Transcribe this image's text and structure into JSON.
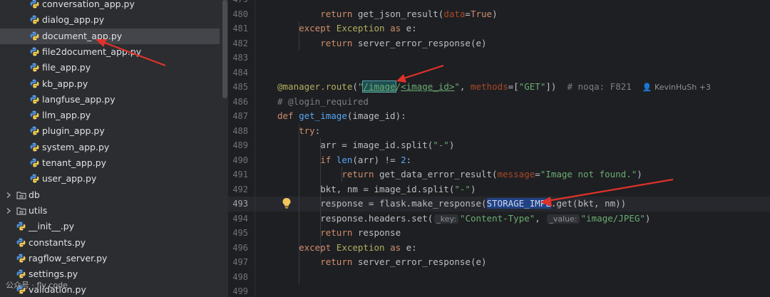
{
  "project_tree": {
    "items": [
      {
        "label": "conversation_app.py",
        "kind": "py",
        "indent": 1
      },
      {
        "label": "dialog_app.py",
        "kind": "py",
        "indent": 1
      },
      {
        "label": "document_app.py",
        "kind": "py",
        "indent": 1,
        "selected": true
      },
      {
        "label": "file2document_app.py",
        "kind": "py",
        "indent": 1
      },
      {
        "label": "file_app.py",
        "kind": "py",
        "indent": 1
      },
      {
        "label": "kb_app.py",
        "kind": "py",
        "indent": 1
      },
      {
        "label": "langfuse_app.py",
        "kind": "py",
        "indent": 1
      },
      {
        "label": "llm_app.py",
        "kind": "py",
        "indent": 1
      },
      {
        "label": "plugin_app.py",
        "kind": "py",
        "indent": 1
      },
      {
        "label": "system_app.py",
        "kind": "py",
        "indent": 1
      },
      {
        "label": "tenant_app.py",
        "kind": "py",
        "indent": 1
      },
      {
        "label": "user_app.py",
        "kind": "py",
        "indent": 1
      },
      {
        "label": "db",
        "kind": "folder",
        "indent": 0
      },
      {
        "label": "utils",
        "kind": "folder",
        "indent": 0
      },
      {
        "label": "__init__.py",
        "kind": "py",
        "indent": 0
      },
      {
        "label": "constants.py",
        "kind": "py",
        "indent": 0
      },
      {
        "label": "ragflow_server.py",
        "kind": "py",
        "indent": 0
      },
      {
        "label": "settings.py",
        "kind": "py",
        "indent": 0
      },
      {
        "label": "validation.py",
        "kind": "py",
        "indent": 0
      }
    ]
  },
  "editor": {
    "current_line": "493",
    "lines": [
      {
        "n": "479",
        "html": ""
      },
      {
        "n": "480",
        "html": "        <span class=\"kw\">return</span> get_json_result(<span class=\"pm\">data</span>=<span class=\"kw\">True</span>)"
      },
      {
        "n": "481",
        "html": "    <span class=\"kw\">except</span> <span class=\"dc\">Exception</span> <span class=\"kw\">as</span> e:"
      },
      {
        "n": "482",
        "html": "        <span class=\"kw\">return</span> server_error_response(e)"
      },
      {
        "n": "483",
        "html": ""
      },
      {
        "n": "484",
        "html": ""
      },
      {
        "n": "485",
        "html": "<span class=\"dc\">@manager.route</span>(<span class=\"st\">\"<span class=\"hl2 ul\">/image</span>/<span class=\"ul\">&lt;image_id&gt;</span>\"</span>, <span class=\"pm\">methods</span>=[<span class=\"st\">\"GET\"</span>])  <span class=\"cm\"># noqa: F821</span>  <span class=\"author\">&#128100; KevinHuSh +3</span>"
      },
      {
        "n": "486",
        "html": "<span class=\"cm\"># @login_required</span>"
      },
      {
        "n": "487",
        "html": "<span class=\"kw\">def</span> <span class=\"fn\">get_image</span>(image_id):"
      },
      {
        "n": "488",
        "html": "    <span class=\"kw\">try</span>:"
      },
      {
        "n": "489",
        "html": "        arr = image_id.split(<span class=\"st\">\"-\"</span>)"
      },
      {
        "n": "490",
        "html": "        <span class=\"kw\">if</span> <span class=\"fn\">len</span>(arr) != <span class=\"fn\">2</span>:"
      },
      {
        "n": "491",
        "html": "            <span class=\"kw\">return</span> get_data_error_result(<span class=\"pm\">message</span>=<span class=\"st\">\"Image not found.\"</span>)"
      },
      {
        "n": "492",
        "html": "        bkt, nm = image_id.split(<span class=\"st\">\"-\"</span>)"
      },
      {
        "n": "493",
        "html": "        response = flask.make_response(<span class=\"hl\">STORAGE_IMPL</span>.get(bkt, nm))"
      },
      {
        "n": "494",
        "html": "        response.headers.set(<span class=\"hint\">_key:</span><span class=\"st\">\"Content-Type\"</span>, <span class=\"hint\">_value:</span><span class=\"st\">\"image/JPEG\"</span>)"
      },
      {
        "n": "495",
        "html": "        <span class=\"kw\">return</span> response"
      },
      {
        "n": "496",
        "html": "    <span class=\"kw\">except</span> <span class=\"dc\">Exception</span> <span class=\"kw\">as</span> e:"
      },
      {
        "n": "497",
        "html": "        <span class=\"kw\">return</span> server_error_response(e)"
      },
      {
        "n": "498",
        "html": ""
      },
      {
        "n": "499",
        "html": ""
      }
    ]
  },
  "watermark": "公众号 · fly code",
  "colors": {
    "annotation_arrow": "#e0322b",
    "selection": "#214283"
  }
}
